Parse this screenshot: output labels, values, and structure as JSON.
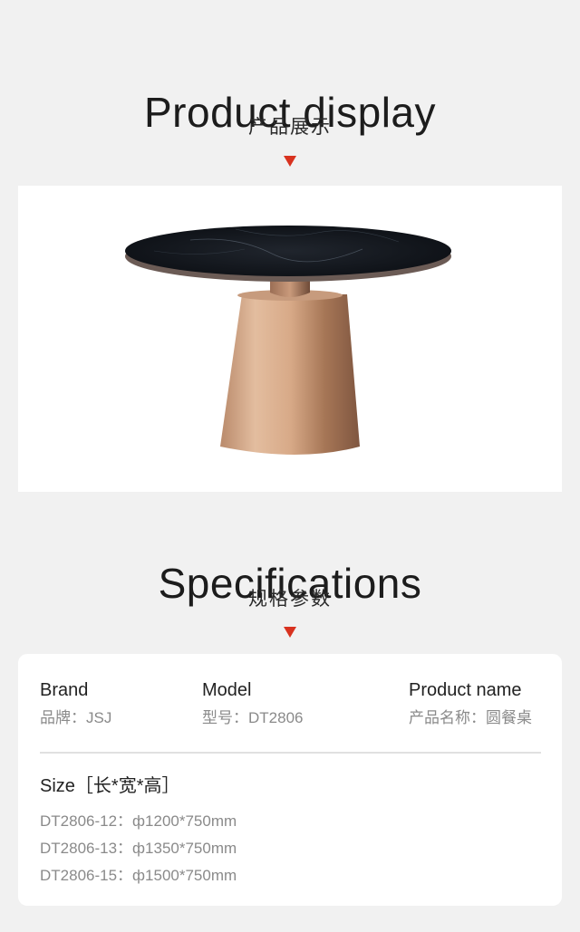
{
  "display": {
    "title": "Product display",
    "subtitle": "产品展示"
  },
  "specs": {
    "title": "Specifications",
    "subtitle": "规格参数",
    "brand": {
      "label": "Brand",
      "value": "品牌：JSJ"
    },
    "model": {
      "label": "Model",
      "value": "型号：DT2806"
    },
    "product_name": {
      "label": "Product name",
      "value": "产品名称：圆餐桌"
    },
    "size": {
      "label": "Size［长*宽*高］",
      "items": [
        "DT2806-12：ф1200*750mm",
        "DT2806-13：ф1350*750mm",
        "DT2806-15：ф1500*750mm"
      ]
    }
  },
  "colors": {
    "accent_triangle": "#d8321f",
    "page_background": "#f1f1f1",
    "card_background": "#ffffff"
  }
}
